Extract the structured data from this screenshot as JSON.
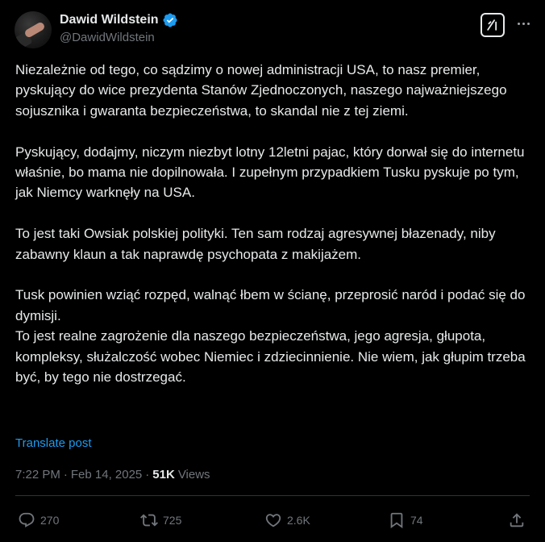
{
  "author": {
    "display_name": "Dawid Wildstein",
    "handle": "@DawidWildstein",
    "verified": true,
    "verified_color": "#1d9bf0"
  },
  "header_actions": {
    "grok_icon": "grok-icon",
    "more_icon": "more-dots-icon"
  },
  "post": {
    "paragraphs": [
      "Niezależnie od tego, co sądzimy o nowej administracji USA, to nasz premier, pyskujący do wice prezydenta Stanów Zjednoczonych, naszego najważniejszego sojusznika i gwaranta bezpieczeństwa, to skandal nie z tej ziemi.",
      "Pyskujący, dodajmy, niczym niezbyt lotny 12letni pajac, który dorwał się do internetu właśnie, bo mama nie dopilnowała. I zupełnym przypadkiem Tusku pyskuje po tym, jak Niemcy warknęły na USA.",
      "To jest taki Owsiak polskiej polityki. Ten sam rodzaj agresywnej błazenady, niby zabawny klaun a tak naprawdę psychopata z makijażem.",
      "Tusk powinien wziąć rozpęd, walnąć łbem w ścianę, przeprosić naród i podać się do dymisji.\nTo jest realne zagrożenie dla naszego bezpieczeństwa, jego agresja, głupota, kompleksy, służalczość wobec Niemiec i zdziecinnienie. Nie wiem, jak głupim trzeba być, by tego nie dostrzegać."
    ],
    "translate_label": "Translate post"
  },
  "meta": {
    "time": "7:22 PM",
    "separator": "·",
    "date": "Feb 14, 2025",
    "views_count": "51K",
    "views_label": "Views"
  },
  "actions": {
    "replies": "270",
    "reposts": "725",
    "likes": "2.6K",
    "bookmarks": "74"
  },
  "colors": {
    "background": "#000000",
    "text": "#e7e9ea",
    "muted": "#71767b",
    "link": "#1d9bf0",
    "divider": "#2f3336"
  }
}
